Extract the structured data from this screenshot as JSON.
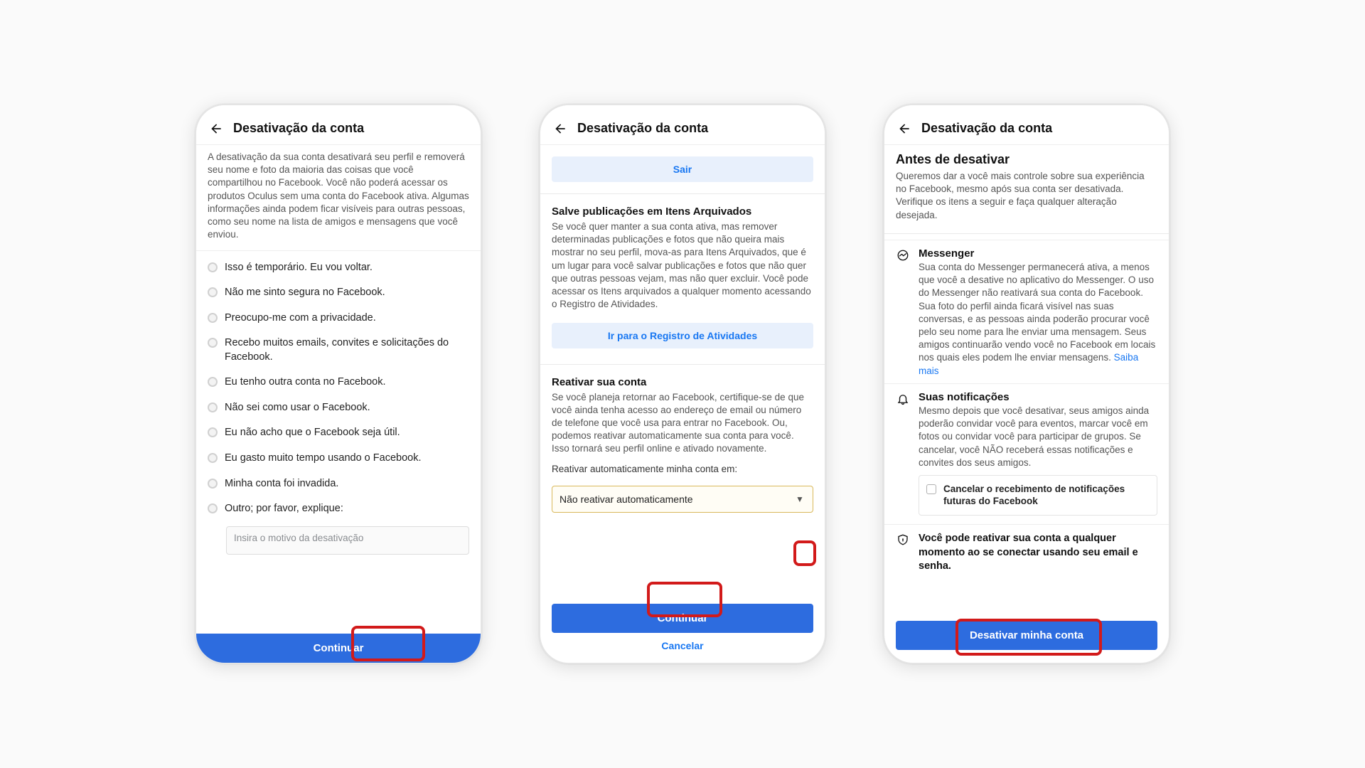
{
  "screen1": {
    "title": "Desativação da conta",
    "description": "A desativação da sua conta desativará seu perfil e removerá seu nome e foto da maioria das coisas que você compartilhou no Facebook. Você não poderá acessar os produtos Oculus sem uma conta do Facebook ativa. Algumas informações ainda podem ficar visíveis para outras pessoas, como seu nome na lista de amigos e mensagens que você enviou.",
    "reasons": [
      "Isso é temporário. Eu vou voltar.",
      "Não me sinto segura no Facebook.",
      "Preocupo-me com a privacidade.",
      "Recebo muitos emails, convites e solicitações do Facebook.",
      "Eu tenho outra conta no Facebook.",
      "Não sei como usar o Facebook.",
      "Eu não acho que o Facebook seja útil.",
      "Eu gasto muito tempo usando o Facebook.",
      "Minha conta foi invadida.",
      "Outro; por favor, explique:"
    ],
    "textarea_placeholder": "Insira o motivo da desativação",
    "continue": "Continuar"
  },
  "screen2": {
    "title": "Desativação da conta",
    "logout": "Sair",
    "archive_title": "Salve publicações em Itens Arquivados",
    "archive_desc": "Se você quer manter a sua conta ativa, mas remover determinadas publicações e fotos que não queira mais mostrar no seu perfil, mova-as para Itens Arquivados, que é um lugar para você salvar publicações e fotos que não quer que outras pessoas vejam, mas não quer excluir. Você pode acessar os Itens arquivados a qualquer momento acessando o Registro de Atividades.",
    "archive_button": "Ir para o Registro de Atividades",
    "reactivate_title": "Reativar sua conta",
    "reactivate_desc": "Se você planeja retornar ao Facebook, certifique-se de que você ainda tenha acesso ao endereço de email ou número de telefone que você usa para entrar no Facebook. Ou, podemos reativar automaticamente sua conta para você. Isso tornará seu perfil online e ativado novamente.",
    "reactivate_label": "Reativar automaticamente minha conta em:",
    "select_value": "Não reativar automaticamente",
    "continue": "Continuar",
    "cancel": "Cancelar"
  },
  "screen3": {
    "title": "Desativação da conta",
    "before_title": "Antes de desativar",
    "before_desc": "Queremos dar a você mais controle sobre sua experiência no Facebook, mesmo após sua conta ser desativada. Verifique os itens a seguir e faça qualquer alteração desejada.",
    "messenger_title": "Messenger",
    "messenger_desc": "Sua conta do Messenger permanecerá ativa, a menos que você a desative no aplicativo do Messenger. O uso do Messenger não reativará sua conta do Facebook. Sua foto do perfil ainda ficará visível nas suas conversas, e as pessoas ainda poderão procurar você pelo seu nome para lhe enviar uma mensagem. Seus amigos continuarão vendo você no Facebook em locais nos quais eles podem lhe enviar mensagens. ",
    "learn_more": "Saiba mais",
    "notifications_title": "Suas notificações",
    "notifications_desc": "Mesmo depois que você desativar, seus amigos ainda poderão convidar você para eventos, marcar você em fotos ou convidar você para participar de grupos. Se cancelar, você NÃO receberá essas notificações e convites dos seus amigos.",
    "checkbox_label": "Cancelar o recebimento de notificações futuras do Facebook",
    "reactivate_note": "Você pode reativar sua conta a qualquer momento ao se conectar usando seu email e senha.",
    "deactivate_btn": "Desativar minha conta"
  }
}
